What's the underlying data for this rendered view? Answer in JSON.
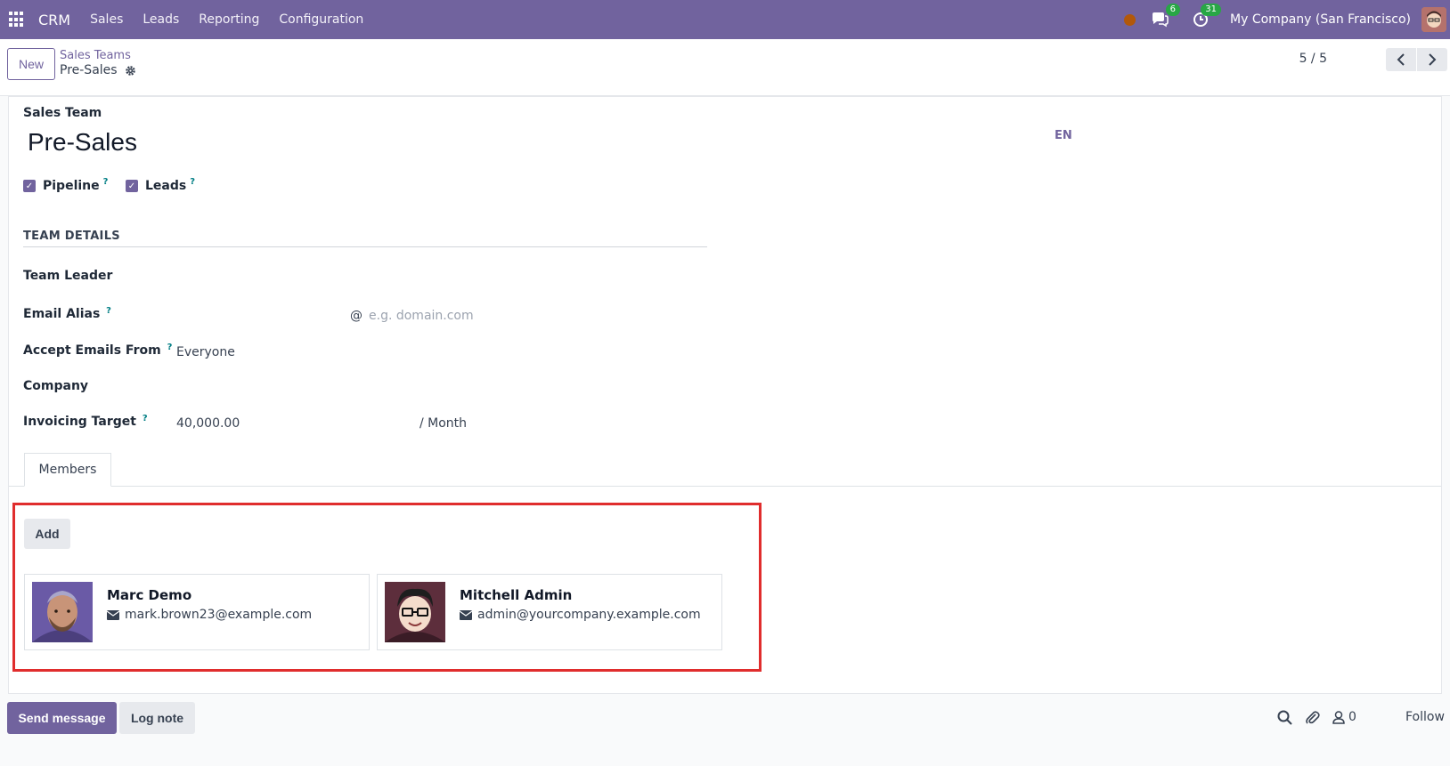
{
  "navbar": {
    "app_name": "CRM",
    "menu": [
      "Sales",
      "Leads",
      "Reporting",
      "Configuration"
    ],
    "messages_count": "6",
    "activities_count": "31",
    "company": "My Company (San Francisco)"
  },
  "control": {
    "new_label": "New",
    "breadcrumb_parent": "Sales Teams",
    "breadcrumb_current": "Pre-Sales",
    "pager": "5 / 5"
  },
  "form": {
    "name_label": "Sales Team",
    "name": "Pre-Sales",
    "lang": "EN",
    "pipeline_label": "Pipeline",
    "pipeline_help": "?",
    "leads_label": "Leads",
    "leads_help": "?",
    "section_title": "TEAM DETAILS",
    "team_leader_label": "Team Leader",
    "email_alias_label": "Email Alias",
    "email_alias_help": "?",
    "alias_at": "@",
    "alias_domain_placeholder": "e.g. domain.com",
    "accept_emails_label": "Accept Emails From",
    "accept_emails_help": "?",
    "accept_emails_value": "Everyone",
    "company_label": "Company",
    "invoicing_target_label": "Invoicing Target",
    "invoicing_target_help": "?",
    "invoicing_target_value": "40,000.00",
    "invoicing_period": "/ Month"
  },
  "members": {
    "tab_label": "Members",
    "add_label": "Add",
    "cards": [
      {
        "name": "Marc Demo",
        "email": "mark.brown23@example.com"
      },
      {
        "name": "Mitchell Admin",
        "email": "admin@yourcompany.example.com"
      }
    ]
  },
  "chatter": {
    "send_label": "Send message",
    "log_label": "Log note",
    "followers_count": "0",
    "follow_label": "Follow"
  },
  "colors": {
    "brand": "#71639e",
    "highlight": "#e02d2d",
    "badge": "#28a745"
  }
}
